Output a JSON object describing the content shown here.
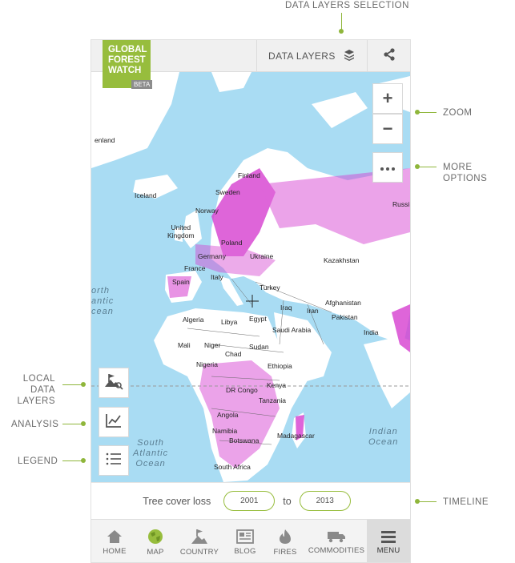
{
  "annotations": {
    "data_layers_selection": "DATA LAYERS SELECTION",
    "zoom": "ZOOM",
    "more_options": "MORE OPTIONS",
    "local_data_layers": [
      "LOCAL DATA",
      "LAYERS"
    ],
    "analysis": "ANALYSIS",
    "legend": "LEGEND",
    "timeline": "TIMELINE"
  },
  "header": {
    "logo_lines": [
      "GLOBAL",
      "FOREST",
      "WATCH"
    ],
    "logo_badge": "BETA",
    "data_layers_label": "DATA LAYERS",
    "icons": {
      "layers": "layers-icon",
      "share": "share-icon"
    }
  },
  "map": {
    "labels": {
      "greenland": "enland",
      "finland": "Finland",
      "iceland": "Iceland",
      "sweden": "Sweden",
      "norway": "Norway",
      "russia": "Russi",
      "uk": [
        "United",
        "Kingdom"
      ],
      "poland": "Poland",
      "germany": "Germany",
      "ukraine": "Ukraine",
      "kazakhstan": "Kazakhstan",
      "france": "France",
      "italy": "Italy",
      "spain": "Spain",
      "turkey": "Turkey",
      "iraq": "Iraq",
      "iran": "Iran",
      "afghanistan": "Afghanistan",
      "algeria": "Algeria",
      "libya": "Libya",
      "egypt": "Egypt",
      "saudi": "Saudi Arabia",
      "pakistan": "Pakistan",
      "india": "India",
      "mali": "Mali",
      "niger": "Niger",
      "chad": "Chad",
      "sudan": "Sudan",
      "nigeria": "Nigeria",
      "ethiopia": "Ethiopia",
      "kenya": "Kenya",
      "drc": "DR Congo",
      "tanzania": "Tanzania",
      "angola": "Angola",
      "namibia": "Namibia",
      "botswana": "Botswana",
      "madagascar": "Madagascar",
      "south_africa": "South Africa"
    },
    "oceans": {
      "north_atlantic": [
        "orth",
        "antic",
        "cean"
      ],
      "south_atlantic": [
        "South",
        "Atlantic",
        "Ocean"
      ],
      "indian": [
        "Indian",
        "Ocean"
      ]
    },
    "controls": {
      "zoom_in": "+",
      "zoom_out": "−",
      "icons": {
        "more": "more-options-icon",
        "local_layers": "local-data-layers-icon",
        "analysis": "analysis-chart-icon",
        "legend": "legend-list-icon"
      }
    }
  },
  "timeline": {
    "label": "Tree cover loss",
    "start_year": "2001",
    "separator": "to",
    "end_year": "2013"
  },
  "nav": {
    "items": [
      {
        "label": "HOME",
        "icon": "home-icon"
      },
      {
        "label": "MAP",
        "icon": "globe-icon"
      },
      {
        "label": "COUNTRY",
        "icon": "country-icon"
      },
      {
        "label": "BLOG",
        "icon": "blog-icon"
      },
      {
        "label": "FIRES",
        "icon": "fire-icon"
      },
      {
        "label": "COMMODITIES",
        "icon": "truck-icon"
      },
      {
        "label": "MENU",
        "icon": "menu-icon"
      }
    ],
    "active": "MENU"
  },
  "colors": {
    "brand_green": "#97bd3d",
    "ocean": "#a9dcf3",
    "loss_magenta": "#d63fd0"
  }
}
